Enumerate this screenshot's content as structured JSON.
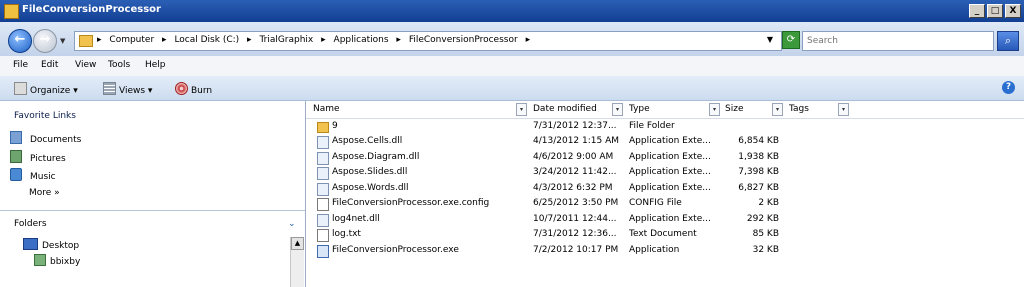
{
  "window": {
    "title": "FileConversionProcessor",
    "controls": [
      "_",
      "□",
      "X"
    ]
  },
  "address": {
    "breadcrumbs": [
      "Computer",
      "Local Disk (C:)",
      "TrialGraphix",
      "Applications",
      "FileConversionProcessor"
    ],
    "search_placeholder": "Search"
  },
  "menu": [
    "File",
    "Edit",
    "View",
    "Tools",
    "Help"
  ],
  "toolbar": {
    "organize": "Organize",
    "views": "Views",
    "burn": "Burn"
  },
  "nav": {
    "favorites_title": "Favorite Links",
    "favorites": [
      "Documents",
      "Pictures",
      "Music"
    ],
    "more": "More »",
    "folders_title": "Folders",
    "tree": [
      "Desktop",
      "bbixby"
    ]
  },
  "columns": {
    "name": "Name",
    "date": "Date modified",
    "type": "Type",
    "size": "Size",
    "tags": "Tags"
  },
  "files": [
    {
      "name": "9",
      "date": "7/31/2012 12:37...",
      "type": "File Folder",
      "size": "",
      "icon": "folder"
    },
    {
      "name": "Aspose.Cells.dll",
      "date": "4/13/2012 1:15 AM",
      "type": "Application Exte...",
      "size": "6,854 KB",
      "icon": "dll"
    },
    {
      "name": "Aspose.Diagram.dll",
      "date": "4/6/2012 9:00 AM",
      "type": "Application Exte...",
      "size": "1,938 KB",
      "icon": "dll"
    },
    {
      "name": "Aspose.Slides.dll",
      "date": "3/24/2012 11:42...",
      "type": "Application Exte...",
      "size": "7,398 KB",
      "icon": "dll"
    },
    {
      "name": "Aspose.Words.dll",
      "date": "4/3/2012 6:32 PM",
      "type": "Application Exte...",
      "size": "6,827 KB",
      "icon": "dll"
    },
    {
      "name": "FileConversionProcessor.exe.config",
      "date": "6/25/2012 3:50 PM",
      "type": "CONFIG File",
      "size": "2 KB",
      "icon": "txt"
    },
    {
      "name": "log4net.dll",
      "date": "10/7/2011 12:44...",
      "type": "Application Exte...",
      "size": "292 KB",
      "icon": "dll"
    },
    {
      "name": "log.txt",
      "date": "7/31/2012 12:36...",
      "type": "Text Document",
      "size": "85 KB",
      "icon": "txt"
    },
    {
      "name": "FileConversionProcessor.exe",
      "date": "7/2/2012 10:17 PM",
      "type": "Application",
      "size": "32 KB",
      "icon": "exe"
    }
  ]
}
